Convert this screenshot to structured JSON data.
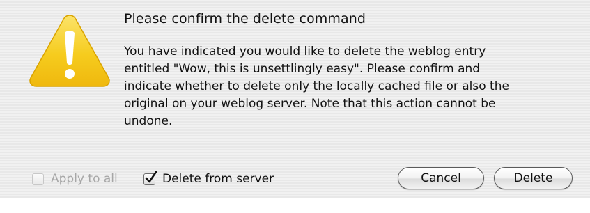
{
  "dialog": {
    "title": "Please confirm the delete command",
    "message_lines": [
      "You have indicated you would like to delete the weblog entry",
      "entitled \"Wow, this is unsettlingly easy\". Please confirm and",
      "indicate whether to delete only the locally cached file or also the",
      "original on your weblog server. Note that this action cannot be",
      "undone."
    ],
    "icon": "warning-triangle-icon",
    "colors": {
      "icon_fill": "#f6cc1e",
      "icon_exclamation": "#ffffff",
      "disabled_text": "#a6a6a6"
    }
  },
  "options": {
    "apply_to_all": {
      "label": "Apply to all",
      "checked": false,
      "enabled": false
    },
    "delete_from_server": {
      "label": "Delete from server",
      "checked": true,
      "enabled": true
    }
  },
  "buttons": {
    "cancel_label": "Cancel",
    "delete_label": "Delete"
  }
}
